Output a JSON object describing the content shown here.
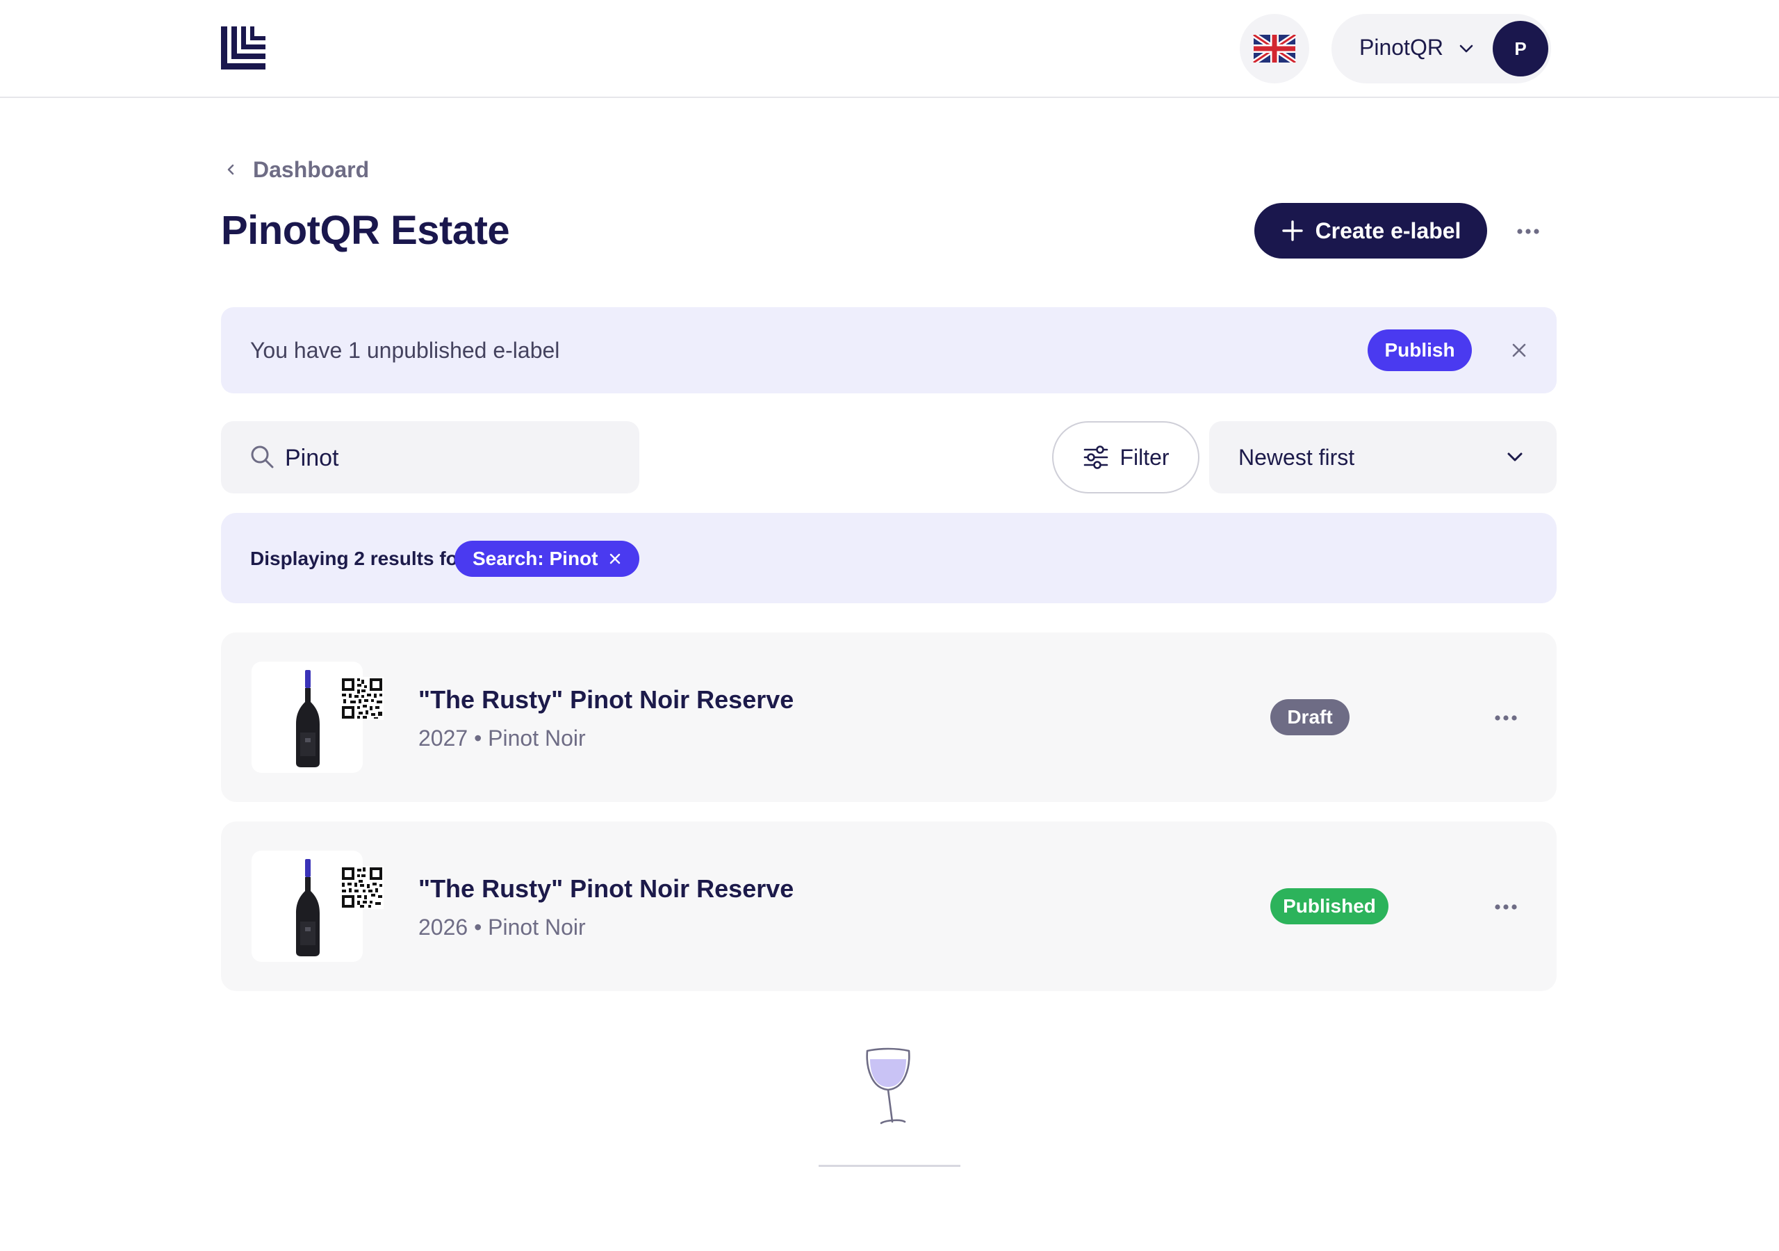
{
  "header": {
    "logo_icon": "brand-logo-icon",
    "language_icon": "uk-flag-icon",
    "account_name": "PinotQR",
    "avatar_initial": "P"
  },
  "breadcrumb": {
    "label": "Dashboard"
  },
  "page": {
    "title": "PinotQR Estate",
    "create_label": "Create e-label"
  },
  "banner": {
    "text": "You have 1 unpublished e-label",
    "publish_label": "Publish"
  },
  "search": {
    "value": "Pinot"
  },
  "filter": {
    "label": "Filter"
  },
  "sort": {
    "selected": "Newest first"
  },
  "results": {
    "text": "Displaying 2 results for",
    "chip_label": "Search: Pinot"
  },
  "items": [
    {
      "title": "\"The Rusty\" Pinot Noir Reserve",
      "subtitle": "2027 • Pinot Noir",
      "status": "Draft"
    },
    {
      "title": "\"The Rusty\" Pinot Noir Reserve",
      "subtitle": "2026 • Pinot Noir",
      "status": "Published"
    }
  ],
  "colors": {
    "navy": "#1a174d",
    "accent": "#4a3af0",
    "banner_bg": "#eeeefc",
    "draft": "#6e6c85",
    "published": "#2cb35b"
  }
}
